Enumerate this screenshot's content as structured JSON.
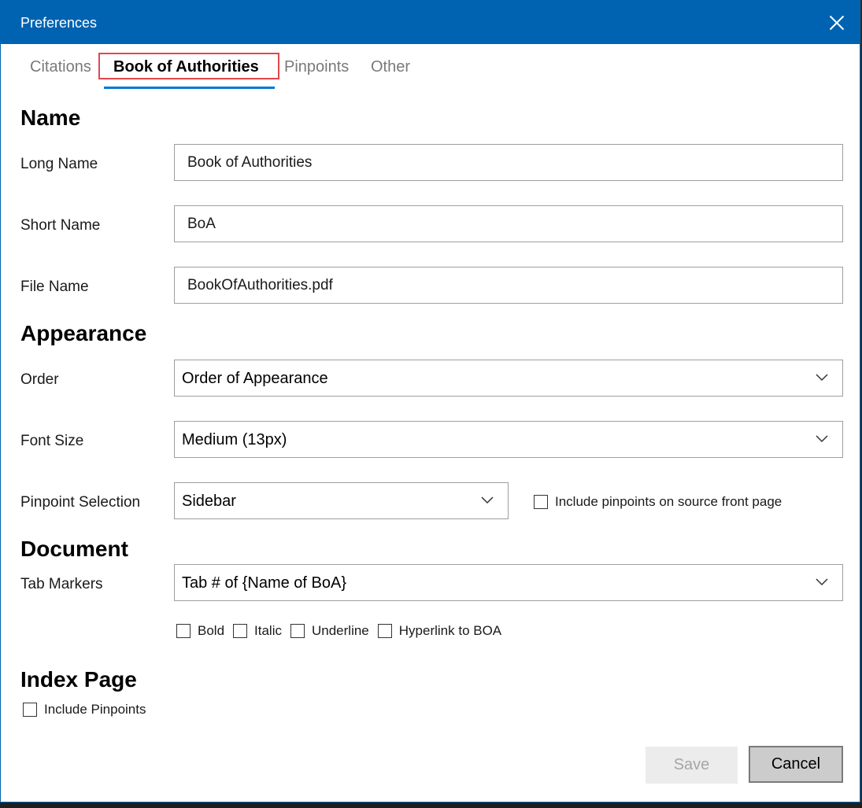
{
  "window": {
    "title": "Preferences"
  },
  "tabs": [
    {
      "label": "Citations",
      "active": false
    },
    {
      "label": "Book of Authorities",
      "active": true
    },
    {
      "label": "Pinpoints",
      "active": false
    },
    {
      "label": "Other",
      "active": false
    }
  ],
  "name_section": {
    "title": "Name",
    "long_name_label": "Long Name",
    "long_name_value": "Book of Authorities",
    "short_name_label": "Short Name",
    "short_name_value": "BoA",
    "file_name_label": "File Name",
    "file_name_value": "BookOfAuthorities.pdf"
  },
  "appearance_section": {
    "title": "Appearance",
    "order_label": "Order",
    "order_value": "Order of Appearance",
    "font_size_label": "Font Size",
    "font_size_value": "Medium (13px)",
    "pinpoint_selection_label": "Pinpoint Selection",
    "pinpoint_selection_value": "Sidebar",
    "include_front_page_label": "Include pinpoints on source front page"
  },
  "document_section": {
    "title": "Document",
    "tab_markers_label": "Tab Markers",
    "tab_markers_value": "Tab # of {Name of BoA}",
    "bold_label": "Bold",
    "italic_label": "Italic",
    "underline_label": "Underline",
    "hyperlink_label": "Hyperlink to BOA"
  },
  "index_section": {
    "title": "Index Page",
    "include_pinpoints_label": "Include Pinpoints"
  },
  "footer": {
    "save_label": "Save",
    "cancel_label": "Cancel"
  },
  "colors": {
    "titlebar": "#0063b1",
    "tab_underline": "#0078d7",
    "tab_highlight": "#e0474c"
  }
}
